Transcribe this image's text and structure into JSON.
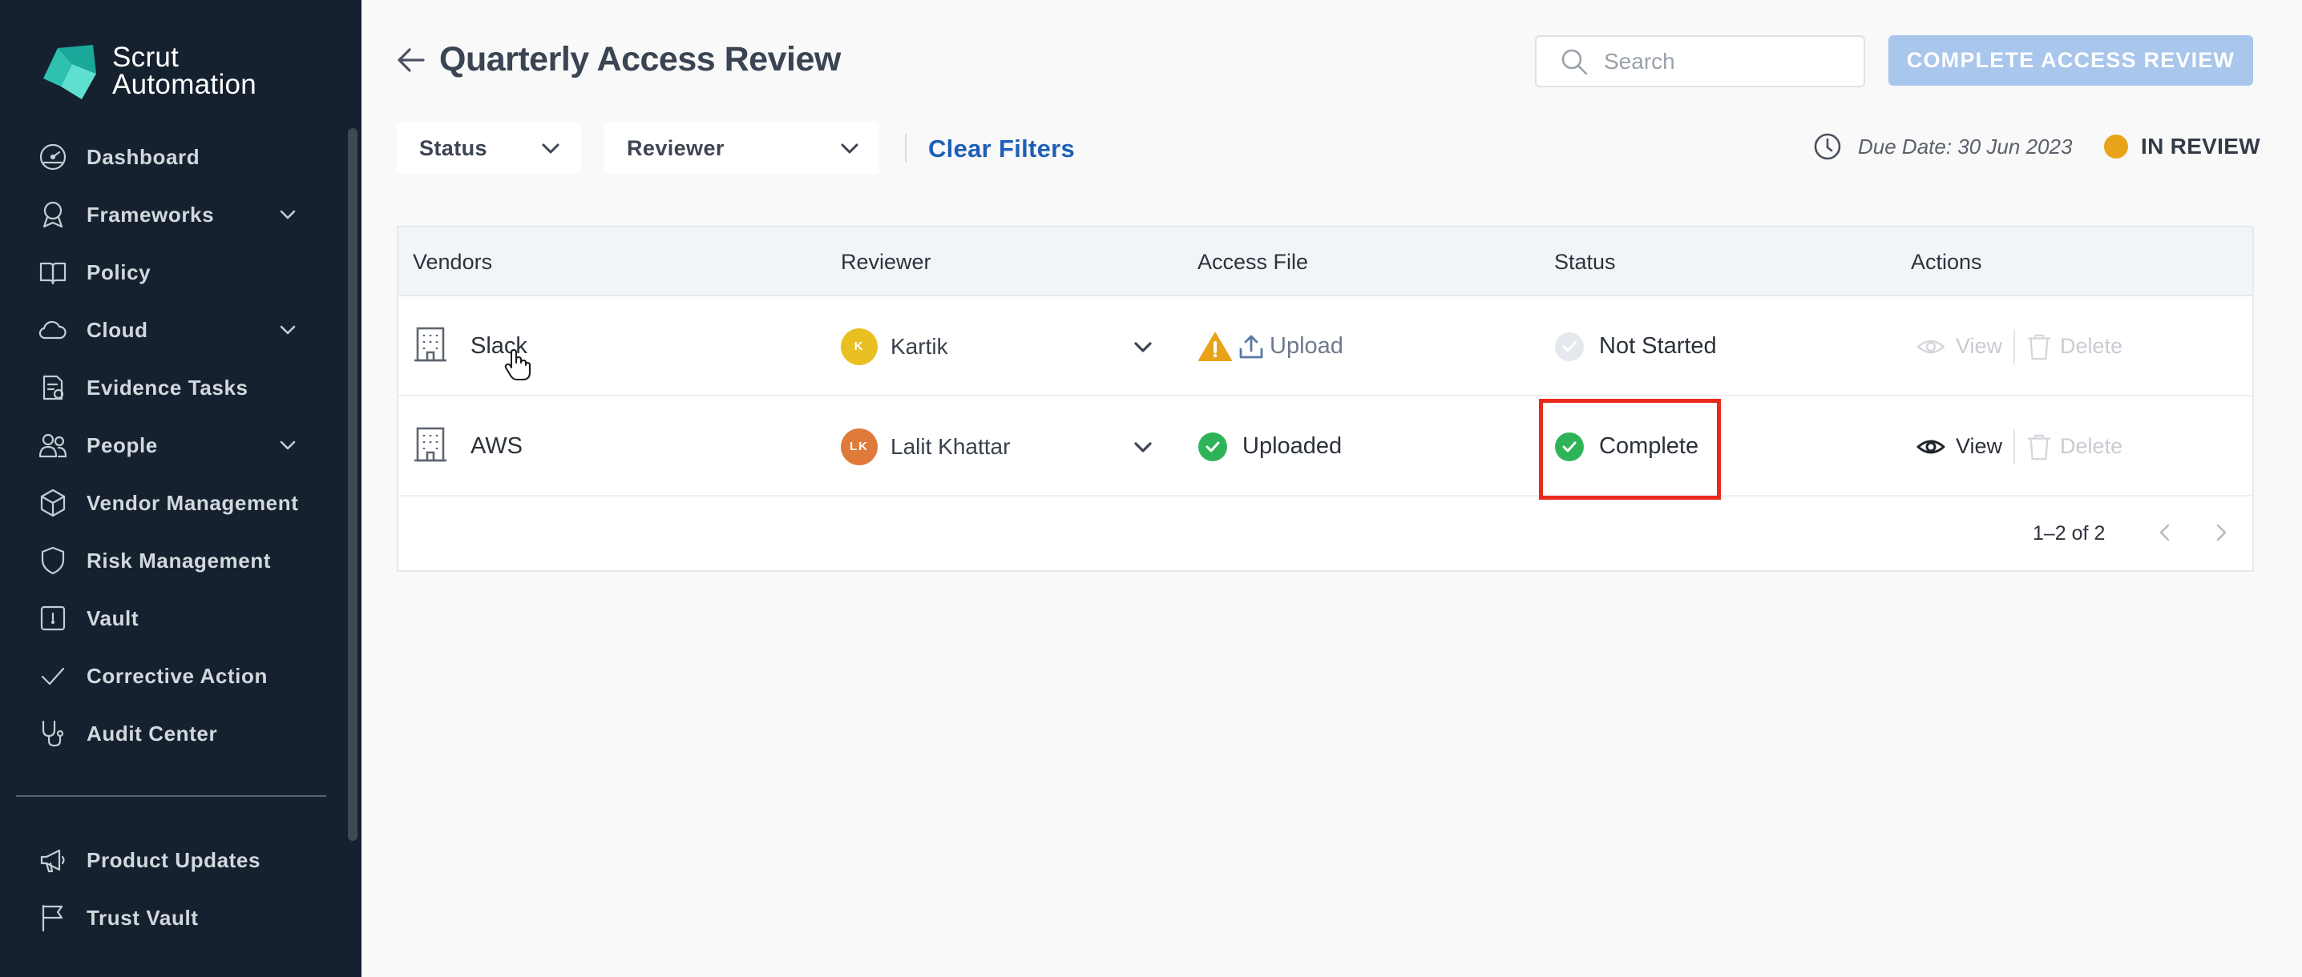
{
  "brand": {
    "name_line1": "Scrut",
    "name_line2": "Automation"
  },
  "sidebar": {
    "items": [
      {
        "label": "Dashboard",
        "icon": "dashboard-icon"
      },
      {
        "label": "Frameworks",
        "icon": "award-icon",
        "expandable": true
      },
      {
        "label": "Policy",
        "icon": "book-icon"
      },
      {
        "label": "Cloud",
        "icon": "cloud-icon",
        "expandable": true
      },
      {
        "label": "Evidence Tasks",
        "icon": "clipboard-icon"
      },
      {
        "label": "People",
        "icon": "people-icon",
        "expandable": true
      },
      {
        "label": "Vendor Management",
        "icon": "box-icon"
      },
      {
        "label": "Risk Management",
        "icon": "shield-icon"
      },
      {
        "label": "Vault",
        "icon": "vault-icon"
      },
      {
        "label": "Corrective Action",
        "icon": "check-icon"
      },
      {
        "label": "Audit Center",
        "icon": "stethoscope-icon"
      }
    ],
    "bottom_items": [
      {
        "label": "Product Updates",
        "icon": "megaphone-icon"
      },
      {
        "label": "Trust Vault",
        "icon": "flag-icon"
      }
    ]
  },
  "header": {
    "title": "Quarterly Access Review",
    "search_placeholder": "Search",
    "complete_button": "COMPLETE ACCESS REVIEW"
  },
  "filters": {
    "status_label": "Status",
    "reviewer_label": "Reviewer",
    "clear_label": "Clear Filters",
    "due_date": "Due Date: 30 Jun 2023",
    "review_status": "IN REVIEW"
  },
  "colors": {
    "sidebar_bg": "#15212f",
    "accent_blue": "#1e5fb5",
    "success_green": "#2fb359",
    "warning_orange": "#e9a319",
    "highlight_red": "#e8291c"
  },
  "table": {
    "columns": [
      "Vendors",
      "Reviewer",
      "Access File",
      "Status",
      "Actions"
    ],
    "rows": [
      {
        "vendor": "Slack",
        "reviewer_initials": "K",
        "reviewer": "Kartik",
        "avatar_color": "#e8c021",
        "access_file": "Upload",
        "access_file_state": "warning",
        "status": "Not Started",
        "status_state": "pending",
        "view_label": "View",
        "delete_label": "Delete"
      },
      {
        "vendor": "AWS",
        "reviewer_initials": "LK",
        "reviewer": "Lalit Khattar",
        "avatar_color": "#e07a3a",
        "access_file": "Uploaded",
        "access_file_state": "success",
        "status": "Complete",
        "status_state": "success",
        "view_label": "View",
        "delete_label": "Delete"
      }
    ],
    "pagination": "1–2 of 2"
  }
}
